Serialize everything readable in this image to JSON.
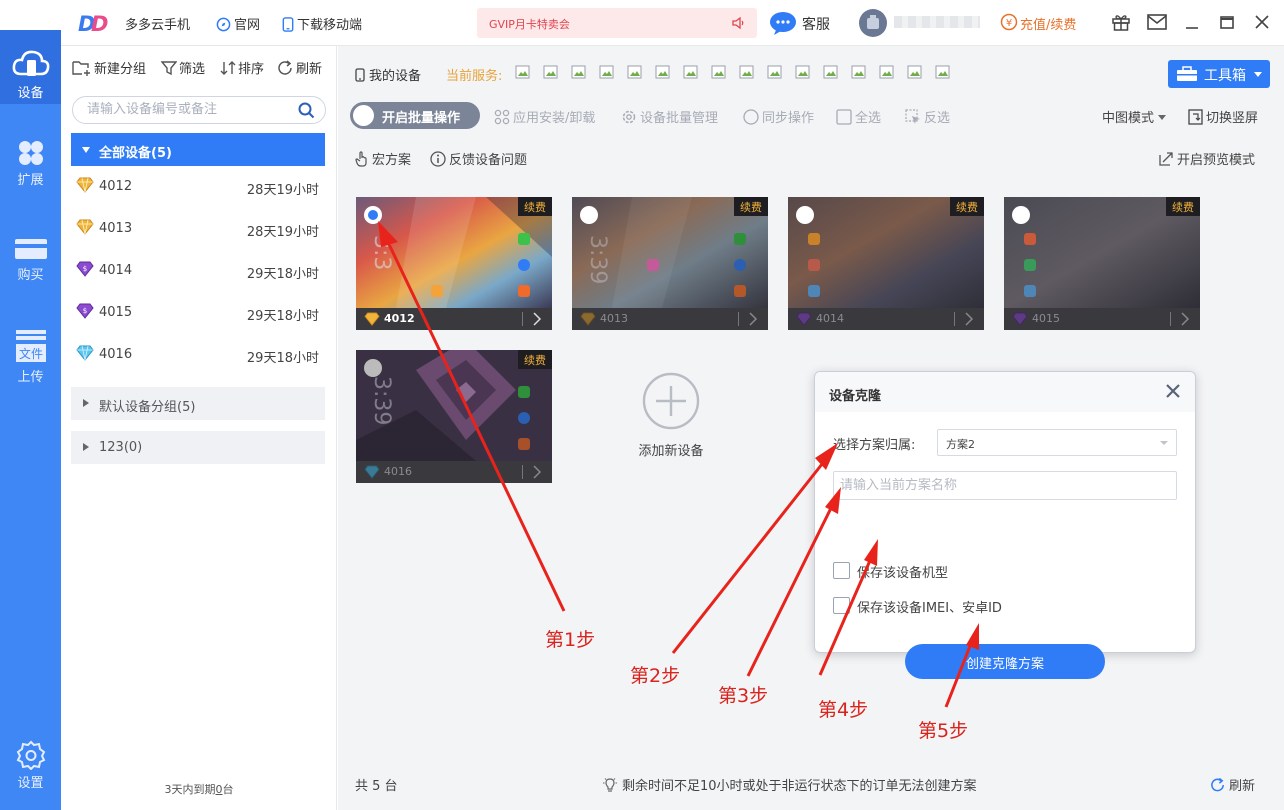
{
  "titlebar": {
    "app_name": "多多云手机",
    "official_site": "官网",
    "download_mobile": "下载移动端",
    "promo": "GVIP月卡特卖会",
    "service": "客服",
    "recharge": "充值/续费"
  },
  "leftnav": {
    "items": [
      {
        "label": "设备",
        "icon": "cloud-phone-icon"
      },
      {
        "label": "扩展",
        "icon": "grid-icon"
      },
      {
        "label": "购买",
        "icon": "card-icon"
      },
      {
        "label": "上传",
        "icon": "file-icon",
        "badge": "文件"
      },
      {
        "label": "设置",
        "icon": "gear-icon"
      }
    ]
  },
  "sidebar": {
    "new_group": "新建分组",
    "filter": "筛选",
    "sort": "排序",
    "refresh": "刷新",
    "search_placeholder": "请输入设备编号或备注",
    "all_devices": "全部设备(5)",
    "devices": [
      {
        "id": "4012",
        "time": "28天19小时",
        "gem": "gold"
      },
      {
        "id": "4013",
        "time": "28天19小时",
        "gem": "gold"
      },
      {
        "id": "4014",
        "time": "29天18小时",
        "gem": "purple"
      },
      {
        "id": "4015",
        "time": "29天18小时",
        "gem": "purple"
      },
      {
        "id": "4016",
        "time": "29天18小时",
        "gem": "cyan"
      }
    ],
    "groups": [
      "默认设备分组(5)",
      "123(0)"
    ],
    "footer_prefix": "3天内到期",
    "footer_count": "0",
    "footer_suffix": "台"
  },
  "main": {
    "my_devices": "我的设备",
    "current_service": "当前服务:",
    "toolbox": "工具箱",
    "batch_toggle": "开启批量操作",
    "ops": [
      "应用安装/卸载",
      "设备批量管理",
      "同步操作",
      "全选",
      "反选"
    ],
    "view_mode": "中图模式",
    "switch_orientation": "切换竖屏",
    "macro": "宏方案",
    "feedback": "反馈设备问题",
    "preview_mode": "开启预览模式",
    "renew_label": "续费",
    "cards": [
      {
        "id": "4012",
        "clock": "3:3",
        "selected": true
      },
      {
        "id": "4013",
        "clock": "3:39",
        "selected": false
      },
      {
        "id": "4014",
        "clock": "",
        "selected": false
      },
      {
        "id": "4015",
        "clock": "",
        "selected": false
      },
      {
        "id": "4016",
        "clock": "3:39",
        "selected": false
      }
    ],
    "add_device": "添加新设备"
  },
  "dialog": {
    "title": "设备克隆",
    "select_label": "选择方案归属:",
    "select_value": "方案2",
    "name_placeholder": "请输入当前方案名称",
    "check_model": "保存该设备机型",
    "check_imei": "保存该设备IMEI、安卓ID",
    "create_button": "创建克隆方案"
  },
  "status": {
    "count": "共 5 台",
    "message": "剩余时间不足10小时或处于非运行状态下的订单无法创建方案",
    "refresh": "刷新"
  },
  "annotations": {
    "steps": [
      "第1步",
      "第2步",
      "第3步",
      "第4步",
      "第5步"
    ]
  },
  "colors": {
    "accent": "#2f7cf6",
    "nav": "#3f87f5",
    "annotation": "#d9231c",
    "renew": "#f2b13b",
    "current_service": "#e8a33b"
  }
}
